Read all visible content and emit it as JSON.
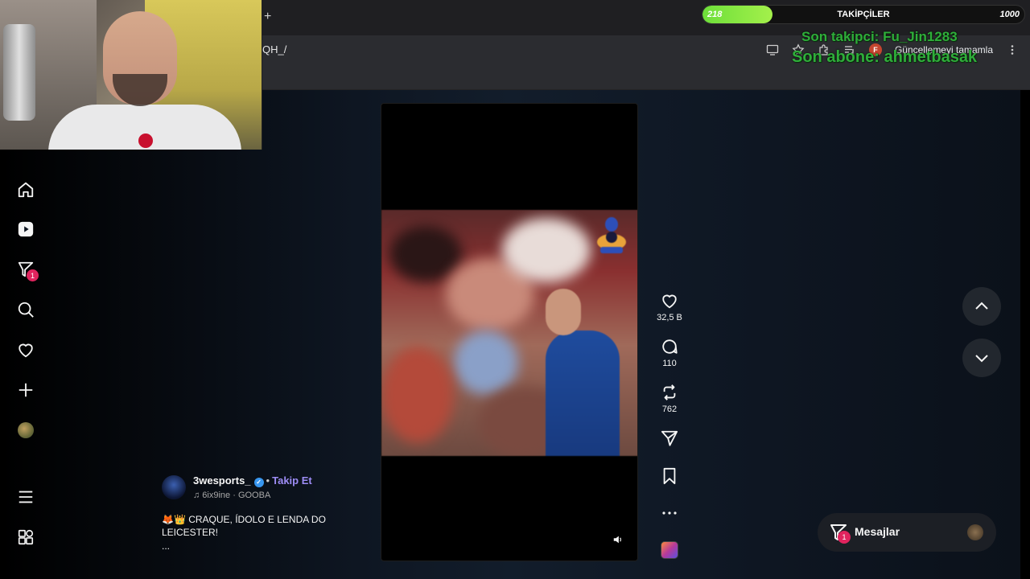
{
  "browser": {
    "new_tab": "+",
    "url_fragment": "QH_/",
    "update_button": "Güncellemeyi tamamla",
    "profile_initial": "F"
  },
  "overlay": {
    "followers_current": "218",
    "followers_label": "TAKİPÇİLER",
    "followers_goal": "1000",
    "followers_progress_fraction": 0.218,
    "last_follower": "Son takipci: Fu_Jin1283",
    "last_subscriber": "Son abone: ahmetbasak"
  },
  "nav": {
    "icons": [
      "home-icon",
      "reels-icon",
      "messages-filter-icon",
      "search-icon",
      "heart-icon",
      "create-icon",
      "profile-avatar",
      "menu-icon",
      "apps-icon"
    ],
    "notifications_badge": "1"
  },
  "post": {
    "username": "3wesports_",
    "follow_label": "Takip Et",
    "separator": "•",
    "music": "♫ 6ix9ine · GOOBA",
    "caption": "🦊👑 CRAQUE, ÍDOLO E LENDA DO LEICESTER!",
    "more": "...",
    "likes": "32,5 B",
    "comments": "110",
    "reposts": "762"
  },
  "messages": {
    "label": "Mesajlar",
    "badge": "1"
  },
  "colors": {
    "accent_link": "#9d8cf5",
    "badge_red": "#e0245e",
    "progress_green": "#6ddf3a",
    "overlay_green": "#2fae3a"
  }
}
